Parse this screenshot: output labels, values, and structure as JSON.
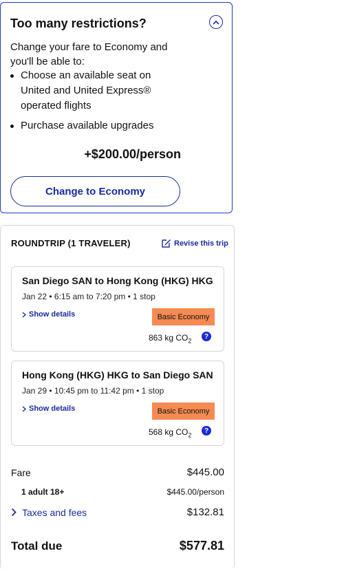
{
  "upsell": {
    "title": "Too many restrictions?",
    "intro": "Change your fare to Economy and you'll be able to:",
    "benefits": [
      "Choose an available seat on United and United Express® operated flights",
      "Purchase available upgrades"
    ],
    "price": "+$200.00/person",
    "button_label": "Change to Economy"
  },
  "summary": {
    "heading": "ROUNDTRIP (1 TRAVELER)",
    "revise_label": "Revise this trip",
    "flights": [
      {
        "route": "San Diego SAN to Hong Kong (HKG) HKG",
        "times": "Jan 22 • 6:15 am to 7:20 pm • 1 stop",
        "details_label": "Show details",
        "fare_class": "Basic Economy",
        "co2_value": "863 kg CO",
        "co2_sub": "2"
      },
      {
        "route": "Hong Kong (HKG) HKG to San Diego SAN",
        "times": "Jan 29 • 10:45 pm to 11:42 pm • 1 stop",
        "details_label": "Show details",
        "fare_class": "Basic Economy",
        "co2_value": "568 kg CO",
        "co2_sub": "2"
      }
    ],
    "fare_label": "Fare",
    "fare_value": "$445.00",
    "traveler_label": "1 adult 18+",
    "traveler_value": "$445.00/person",
    "taxes_label": "Taxes and fees",
    "taxes_value": "$132.81",
    "total_label": "Total due",
    "total_value": "$577.81"
  },
  "colors": {
    "brand_blue": "#1a2a9c",
    "badge_orange": "#f58a52",
    "help_blue": "#1a2ad8"
  },
  "icons": [
    "chevron-up-icon",
    "edit-icon",
    "chevron-right-icon",
    "question-icon"
  ]
}
